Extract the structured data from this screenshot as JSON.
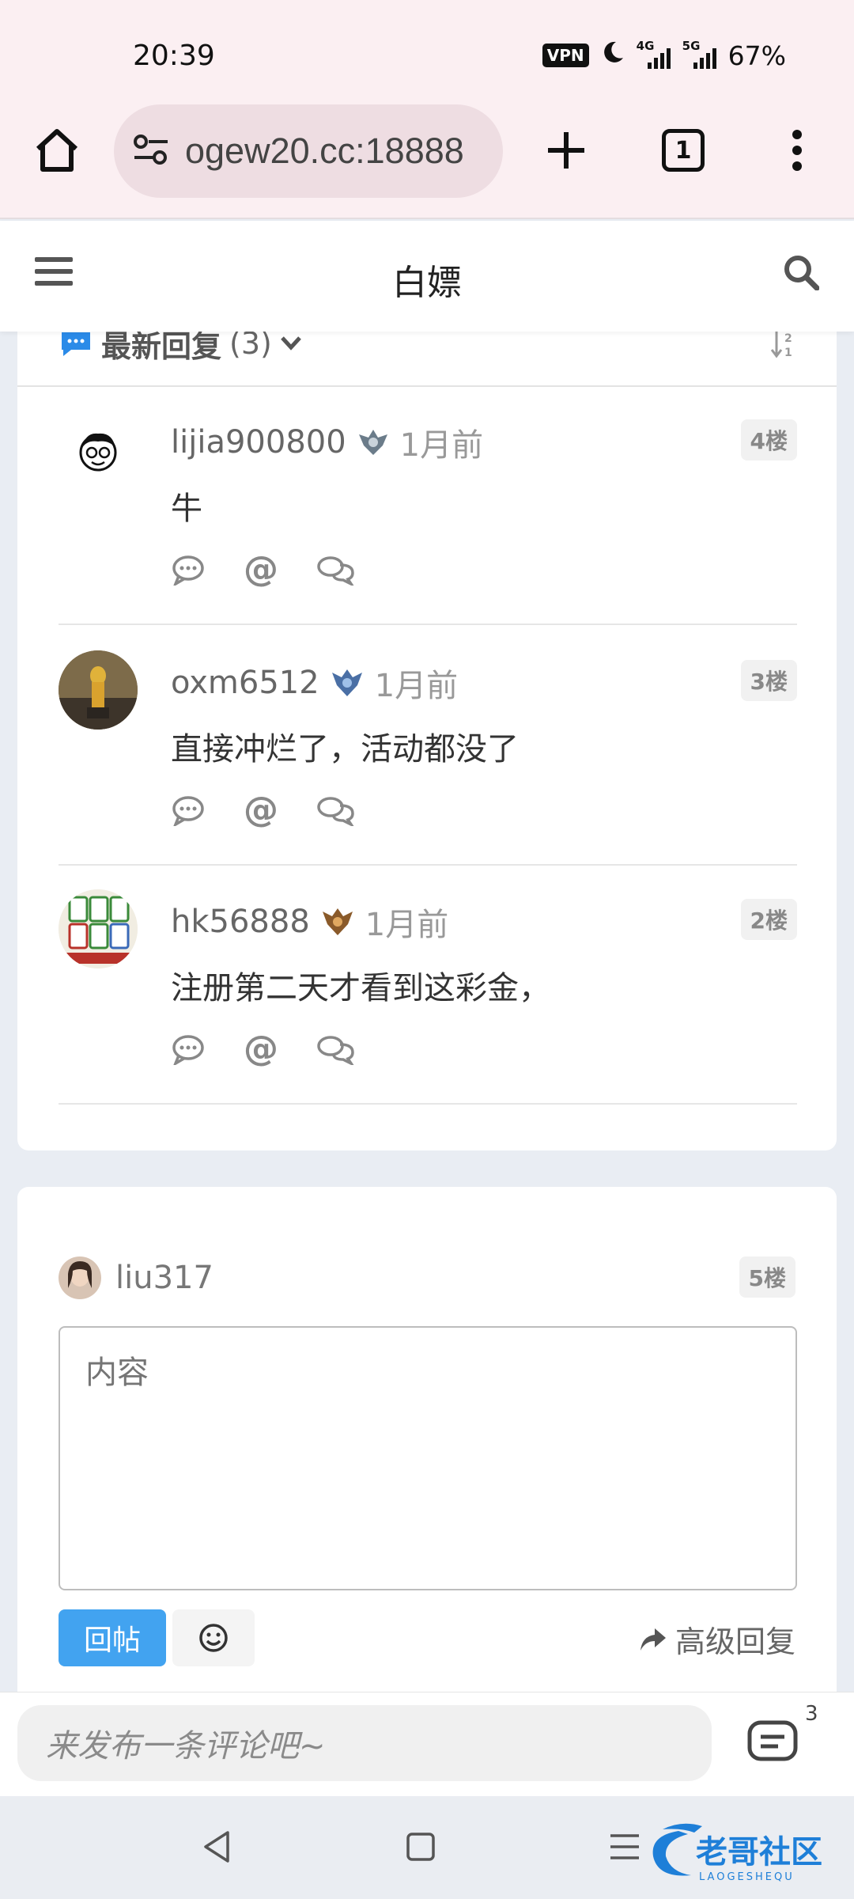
{
  "status_bar": {
    "time": "20:39",
    "vpn": "VPN",
    "net_1": "4G",
    "net_2": "5G",
    "battery": "67%"
  },
  "browser": {
    "url": "ogew20.cc:18888",
    "tab_count": "1"
  },
  "header": {
    "title": "白嫖"
  },
  "replies": {
    "heading": "最新回复",
    "count": "(3)",
    "items": [
      {
        "username": "lijia900800",
        "time": "1月前",
        "floor": "4楼",
        "content": "牛"
      },
      {
        "username": "oxm6512",
        "time": "1月前",
        "floor": "3楼",
        "content": "直接冲烂了，活动都没了"
      },
      {
        "username": "hk56888",
        "time": "1月前",
        "floor": "2楼",
        "content": "注册第二天才看到这彩金，"
      }
    ]
  },
  "compose": {
    "username": "liu317",
    "floor": "5楼",
    "placeholder": "内容",
    "reply_label": "回帖",
    "advanced_label": "高级回复"
  },
  "comment_bar": {
    "placeholder": "来发布一条评论吧~",
    "count": "3"
  },
  "watermark": {
    "text": "老哥社区",
    "subtext": "LAOGESHEQU"
  },
  "colors": {
    "accent_blue": "#42a3f0",
    "chrome_bg": "#fbeff2",
    "url_pill_bg": "#eedde2"
  }
}
